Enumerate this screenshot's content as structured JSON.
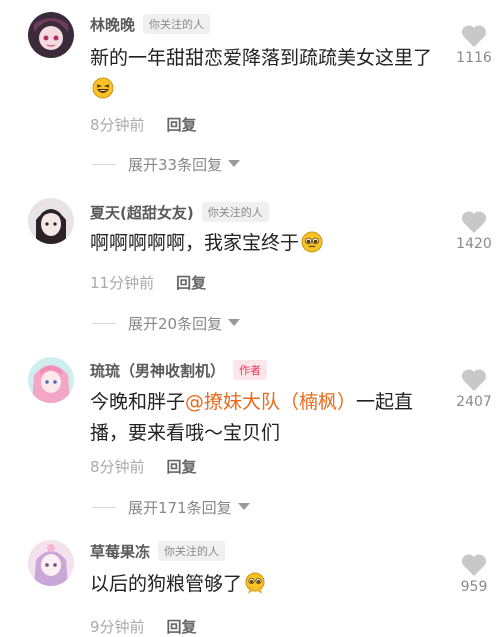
{
  "comments": [
    {
      "username": "林晚晚",
      "tag": "你关注的人",
      "text": "新的一年甜甜恋爱降落到疏疏美女这里了",
      "time": "8分钟前",
      "reply_label": "回复",
      "expand_label": "展开33条回复",
      "likes": "1116",
      "emoji": "laughing-emoji"
    },
    {
      "username": "夏天(超甜女友)",
      "tag": "你关注的人",
      "text": "啊啊啊啊啊，我家宝终于",
      "time": "11分钟前",
      "reply_label": "回复",
      "expand_label": "展开20条回复",
      "likes": "1420",
      "emoji": "pleading-emoji"
    },
    {
      "username": "琉琉（男神收割机）",
      "tag": "作者",
      "text_before": "今晚和胖子",
      "mention": "@撩妹大队（楠枫）",
      "text_after": "一起直播，要来看哦～宝贝们",
      "time": "8分钟前",
      "reply_label": "回复",
      "expand_label": "展开171条回复",
      "likes": "2407"
    },
    {
      "username": "草莓果冻",
      "tag": "你关注的人",
      "text": "以后的狗粮管够了",
      "time": "9分钟前",
      "reply_label": "回复",
      "likes": "959",
      "emoji": "pleading-hands-emoji"
    }
  ],
  "colors": {
    "author_tag": "#f0325a",
    "mention": "#e86a1a",
    "like_icon": "#c8c8c8"
  }
}
